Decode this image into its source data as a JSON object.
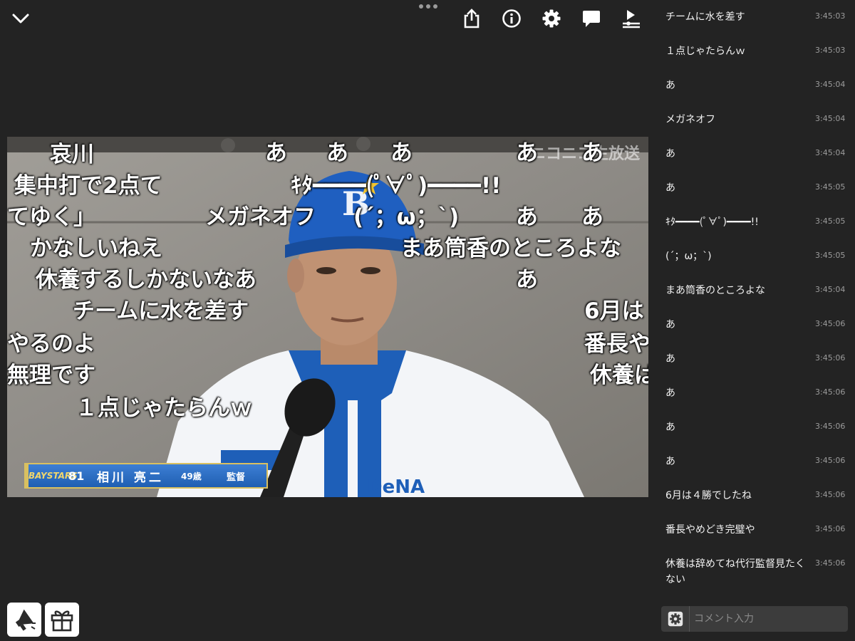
{
  "toolbar": {
    "buttons": [
      {
        "name": "share-icon"
      },
      {
        "name": "info-icon"
      },
      {
        "name": "gear-icon"
      },
      {
        "name": "comment-icon"
      },
      {
        "name": "playlist-icon"
      }
    ]
  },
  "video": {
    "watermark": "ニコニコ生放送",
    "lower_third": {
      "logo": "BAYSTARS",
      "number": "81",
      "name": "相川 亮二",
      "age": "49歳",
      "role": "監督"
    },
    "overlay_comments": [
      "哀川",
      "あ",
      "あ",
      "あ",
      "あ",
      "あ",
      "集中打で2点て",
      "ｷﾀ━━━━(ﾟ∀ﾟ)━━━━!!",
      "てゆく」",
      "メガネオフ",
      "(´；ω；`)",
      "あ",
      "あ",
      "かなしいねえ",
      "まあ筒香のところよな",
      "休養するしかないなあ",
      "あ",
      "チームに水を差す",
      "6月は",
      "やるのよ",
      "番長や",
      "無理です",
      "休養は",
      "１点じゃたらんｗ"
    ]
  },
  "comment_list": [
    {
      "text": "チームに水を差す",
      "time": "3:45:03"
    },
    {
      "text": "１点じゃたらんｗ",
      "time": "3:45:03"
    },
    {
      "text": "あ",
      "time": "3:45:04"
    },
    {
      "text": "メガネオフ",
      "time": "3:45:04"
    },
    {
      "text": "あ",
      "time": "3:45:04"
    },
    {
      "text": "あ",
      "time": "3:45:05"
    },
    {
      "text": "ｷﾀ━━━━(ﾟ∀ﾟ)━━━━!!",
      "time": "3:45:05"
    },
    {
      "text": "(´；ω；`)",
      "time": "3:45:05"
    },
    {
      "text": "まあ筒香のところよな",
      "time": "3:45:04"
    },
    {
      "text": "あ",
      "time": "3:45:06"
    },
    {
      "text": "あ",
      "time": "3:45:06"
    },
    {
      "text": "あ",
      "time": "3:45:06"
    },
    {
      "text": "あ",
      "time": "3:45:06"
    },
    {
      "text": "あ",
      "time": "3:45:06"
    },
    {
      "text": "6月は４勝でしたね",
      "time": "3:45:06"
    },
    {
      "text": "番長やめどき完璧や",
      "time": "3:45:06"
    },
    {
      "text": "休養は辞めてね代行監督見たくない",
      "time": "3:45:06"
    }
  ],
  "comment_input": {
    "placeholder": "コメント入力",
    "value": ""
  },
  "bottom_buttons": [
    {
      "name": "megaphone-icon"
    },
    {
      "name": "gift-icon"
    }
  ]
}
